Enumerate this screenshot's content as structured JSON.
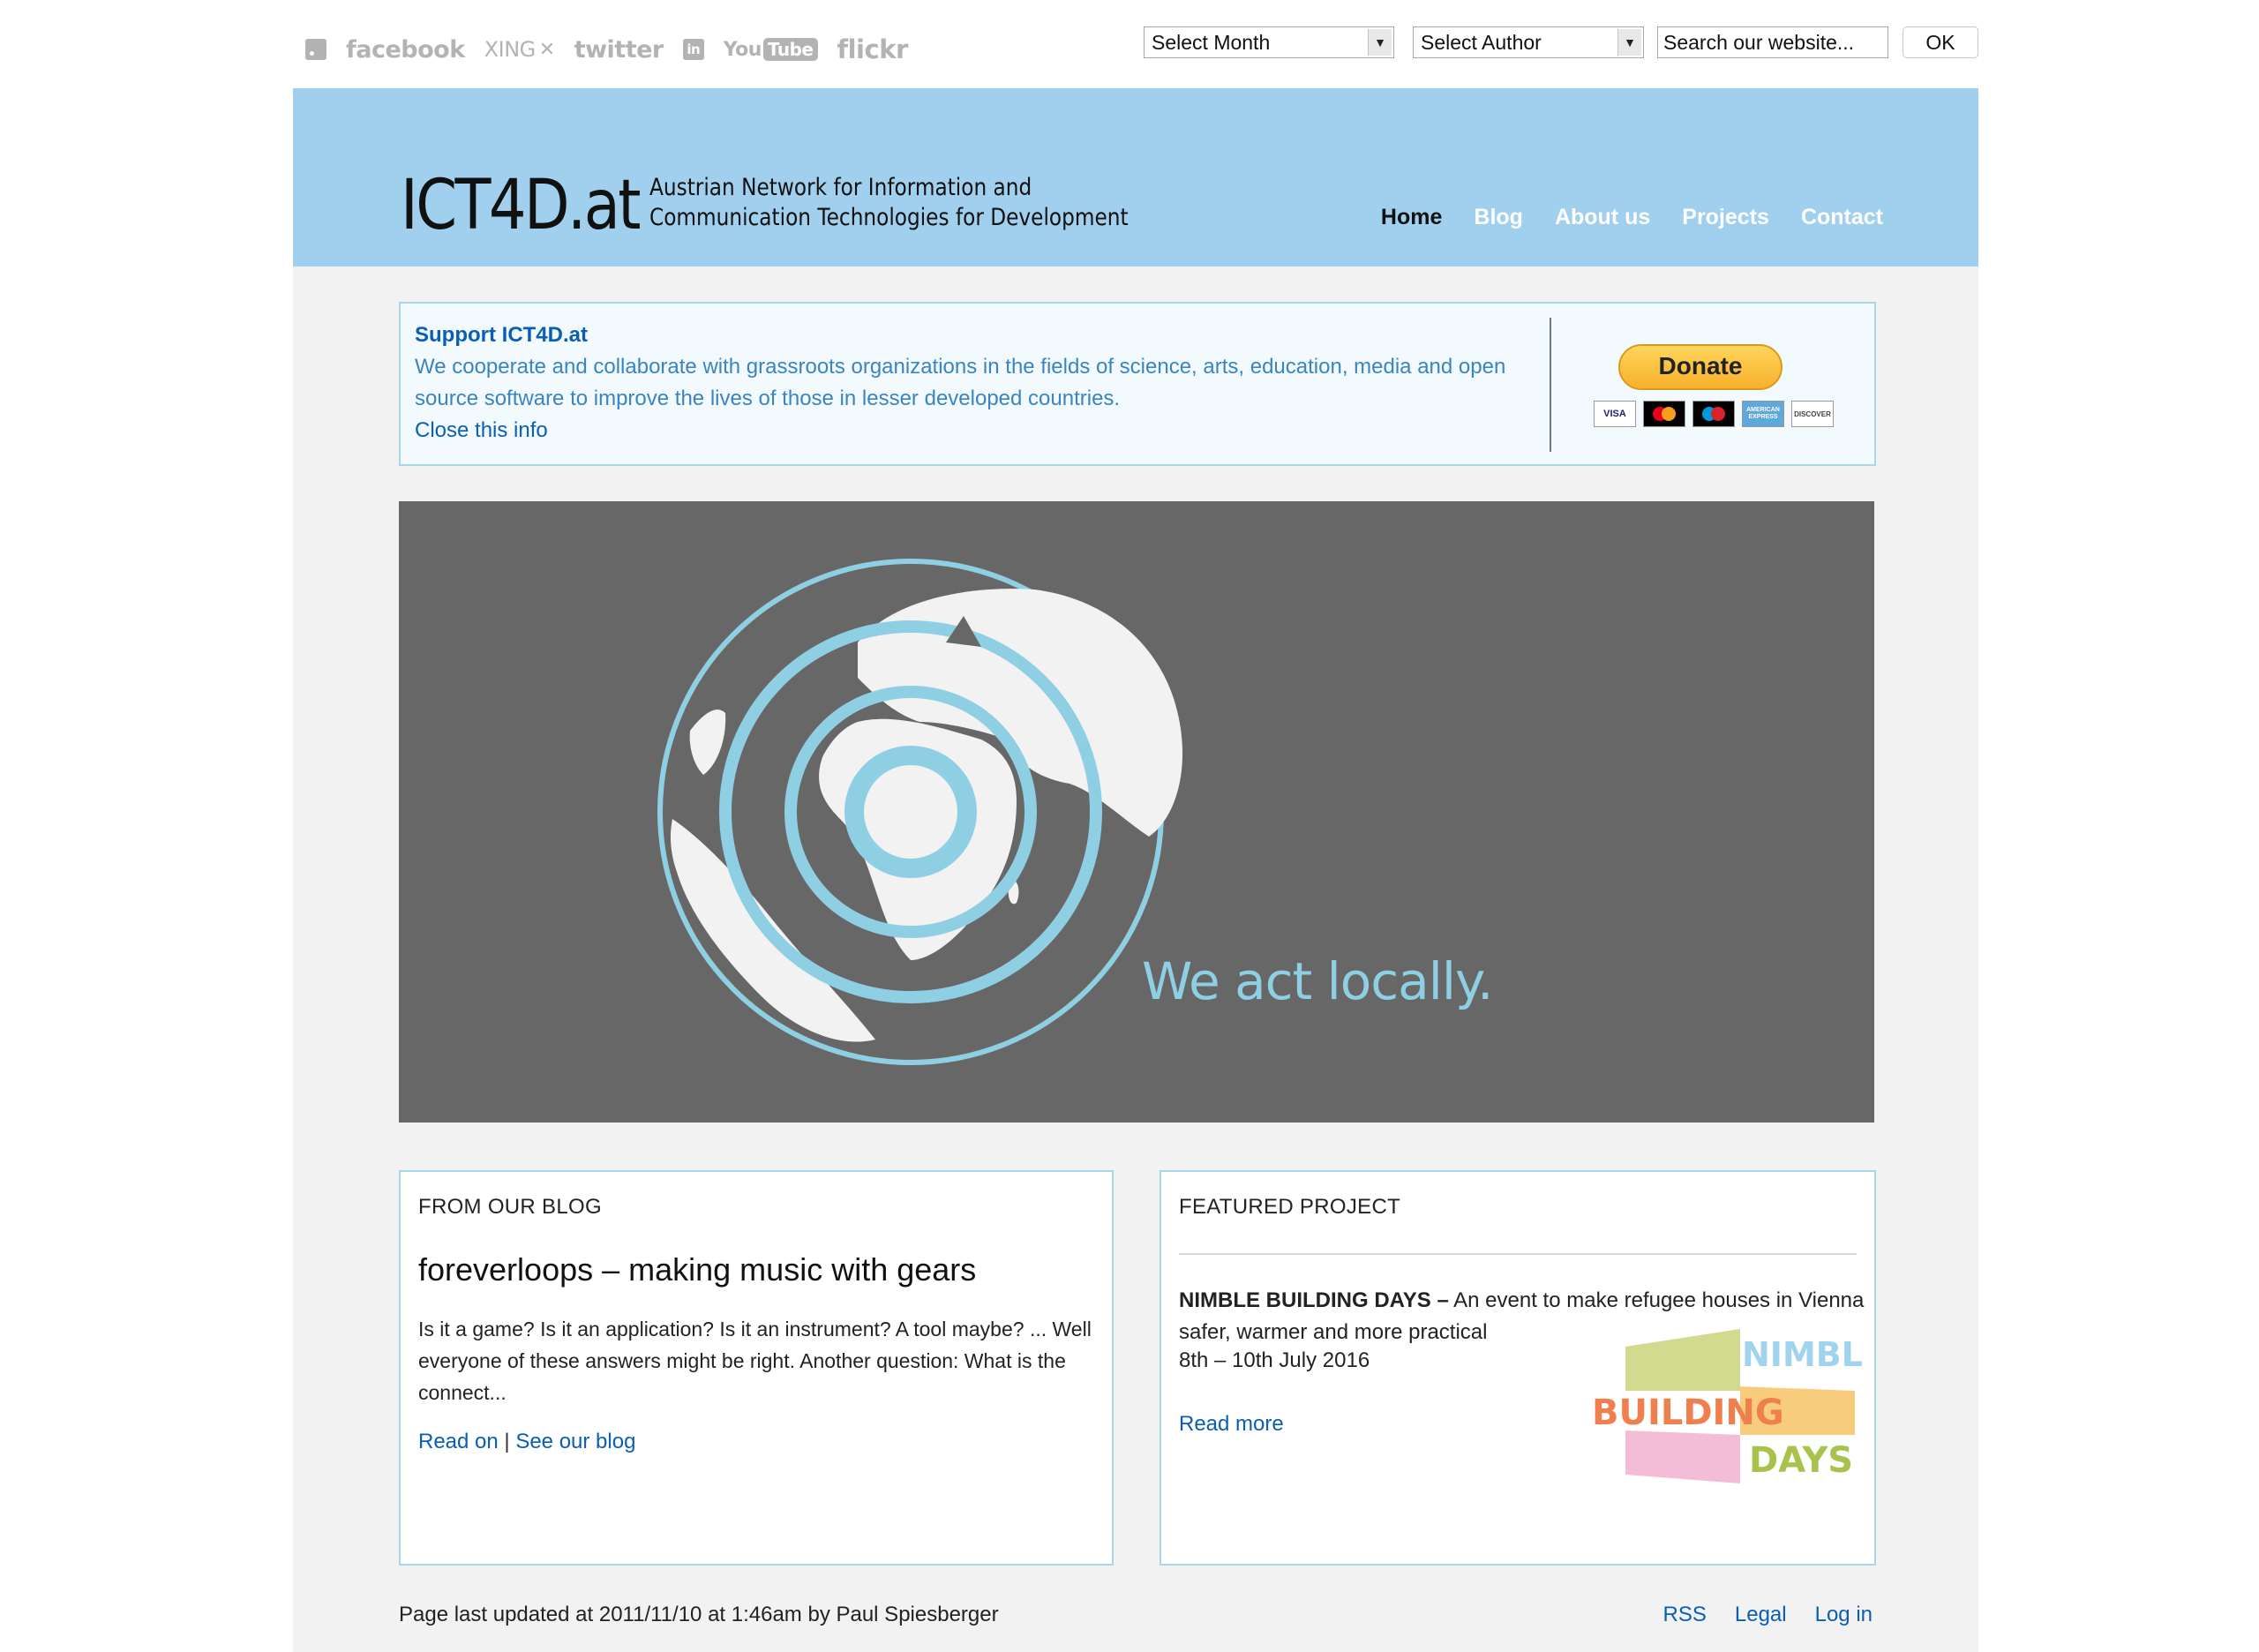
{
  "social": {
    "rss_icon": "rss-icon",
    "facebook": "facebook",
    "xing": "XING",
    "twitter": "twitter",
    "linkedin": "in",
    "youtube_you": "You",
    "youtube_tube": "Tube",
    "flickr": "flickr"
  },
  "toolbar": {
    "month_select": "Select Month",
    "author_select": "Select Author",
    "search_value": "Search our website...",
    "ok_label": "OK"
  },
  "header": {
    "logo": "ICT4D.at",
    "tagline_line1": "Austrian Network for Information and",
    "tagline_line2": "Communication Technologies for Development",
    "background": "#a0d0ee"
  },
  "nav": {
    "items": [
      {
        "label": "Home",
        "active": true
      },
      {
        "label": "Blog"
      },
      {
        "label": "About us"
      },
      {
        "label": "Projects"
      },
      {
        "label": "Contact"
      }
    ]
  },
  "support": {
    "title": "Support ICT4D.at",
    "text": "We cooperate and collaborate with grassroots organizations in the fields of science, arts, education, media and open source software to improve the lives of those in lesser developed countries.",
    "close": "Close this info",
    "donate_label": "Donate",
    "cards": [
      "VISA",
      "mastercard",
      "maestro",
      "AMERICAN EXPRESS",
      "DISCOVER"
    ]
  },
  "hero": {
    "tagline": "We act locally.",
    "accent": "#8fcfe4"
  },
  "blog": {
    "heading": "FROM OUR BLOG",
    "title": "foreverloops – making music with gears",
    "excerpt": "Is it a game? Is it an application? Is it an instrument? A tool maybe? ... Well everyone of these answers might be right. Another question: What is the connect...",
    "read_on": "Read on",
    "separator": "|",
    "see_blog": "See our blog"
  },
  "project": {
    "heading": "FEATURED PROJECT",
    "name": "NIMBLE BUILDING DAYS –",
    "description": " An event to make refugee houses in Vienna safer, warmer and more practical",
    "date": "8th – 10th July 2016",
    "read_more": "Read more",
    "logo_words": [
      "NIMBLE",
      "BUILDING",
      "DAYS"
    ]
  },
  "footer": {
    "updated": "Page last updated at 2011/11/10 at 1:46am by Paul Spiesberger",
    "links": [
      "RSS",
      "Legal",
      "Log in"
    ]
  },
  "colors": {
    "link": "#0a5fb4",
    "content_bg": "#f2f2f2",
    "box_border": "#a9d6ea"
  }
}
